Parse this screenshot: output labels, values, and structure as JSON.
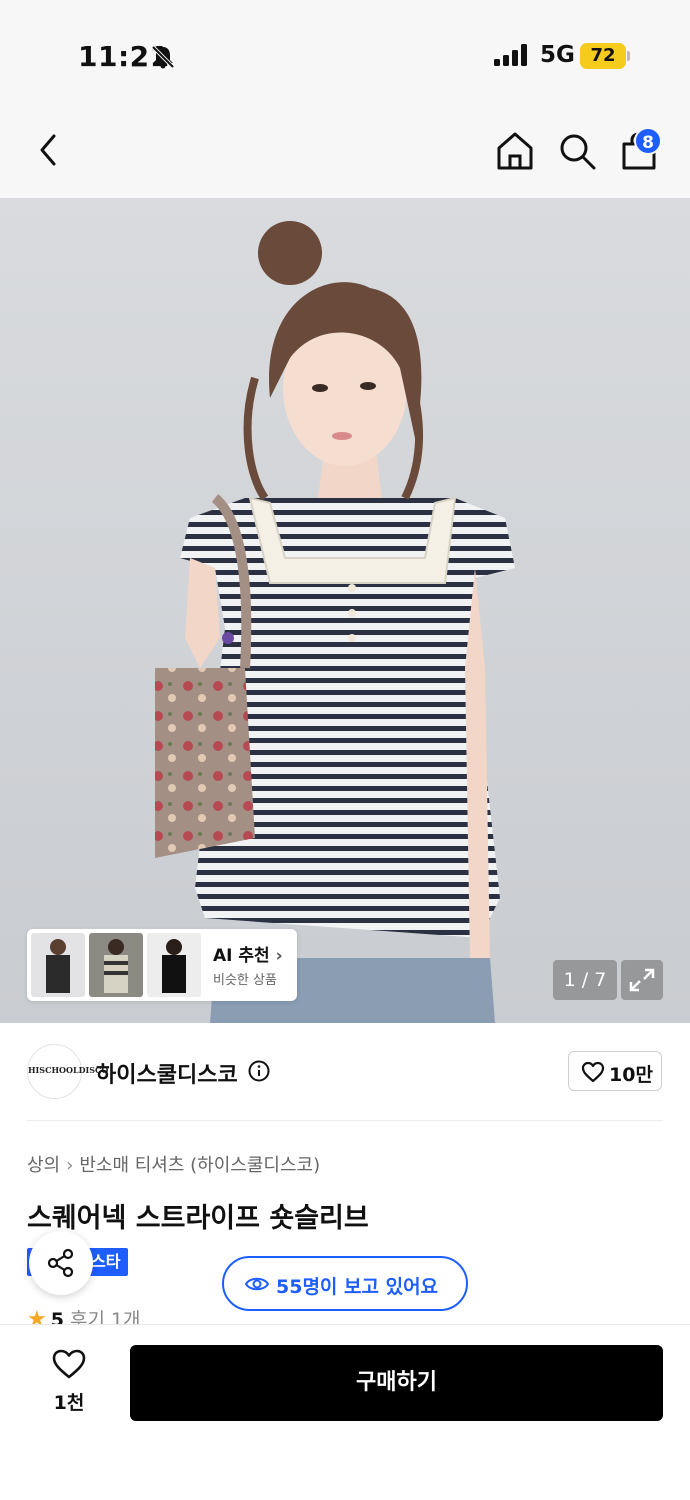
{
  "status_bar": {
    "time": "11:21",
    "network": "5G",
    "battery": "72"
  },
  "nav": {
    "cart_count": "8"
  },
  "gallery": {
    "ai_title": "AI 추천",
    "ai_subtitle": "비슷한 상품",
    "pager": "1 / 7"
  },
  "brand": {
    "logo_text": "HISCHOOLDISCO",
    "name": "하이스쿨디스코",
    "likes": "10만"
  },
  "product": {
    "breadcrumb": [
      "상의",
      "반소매 티셔츠 (하이스쿨디스코)"
    ],
    "title": "스퀘어넥 스트라이프 숏슬리브",
    "tag": "스타",
    "viewers": "55명이 보고 있어요",
    "rating": "5",
    "reviews": "후기 1개"
  },
  "bottom_bar": {
    "wish_count": "1천",
    "buy_label": "구매하기"
  },
  "colors": {
    "accent": "#1e5eff",
    "battery": "#f5cb1c",
    "star": "#f5a623",
    "buy_button": "#000000"
  }
}
